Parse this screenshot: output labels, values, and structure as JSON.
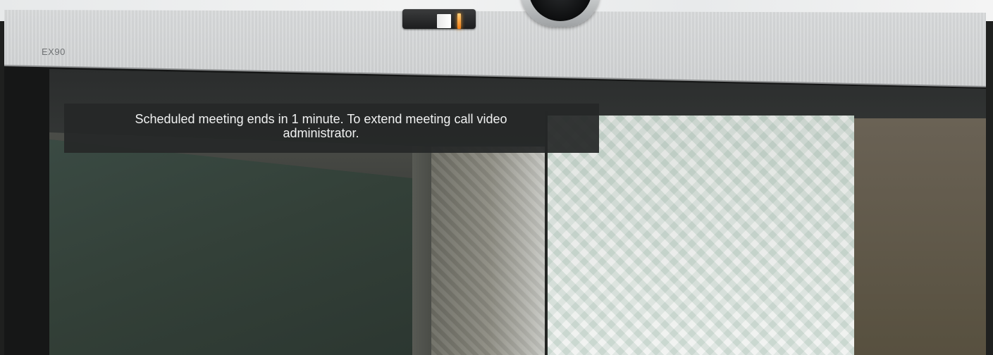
{
  "device": {
    "model_label": "EX90"
  },
  "notification": {
    "message": "Scheduled meeting ends in 1 minute. To extend meeting call video administrator."
  },
  "colors": {
    "bezel": "#c9cbcc",
    "notification_bg": "#262828",
    "notification_text": "#f1f2f2",
    "camera_led": "#f07a12"
  }
}
